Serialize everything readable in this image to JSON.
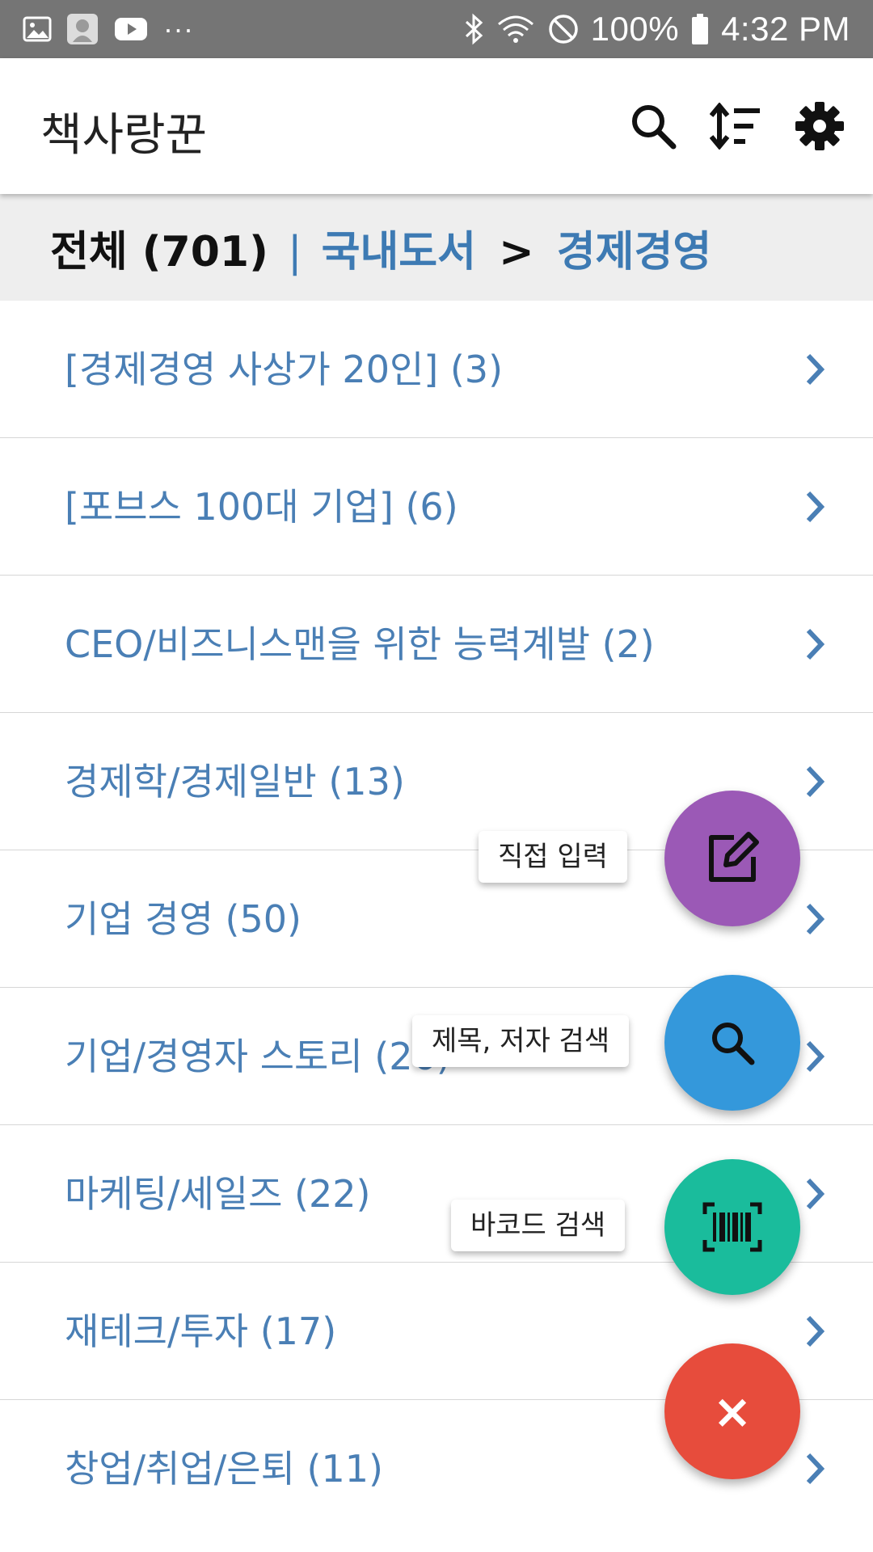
{
  "status_bar": {
    "battery": "100%",
    "time": "4:32 PM",
    "overflow": "···"
  },
  "app_bar": {
    "title": "책사랑꾼"
  },
  "breadcrumb": {
    "all_label": "전체 (701)",
    "separator": "|",
    "level1": "국내도서",
    "arrow": ">",
    "level2": "경제경영"
  },
  "categories": [
    {
      "label": "[경제경영 사상가 20인] (3)"
    },
    {
      "label": "[포브스 100대 기업] (6)"
    },
    {
      "label": "CEO/비즈니스맨을 위한 능력계발 (2)"
    },
    {
      "label": "경제학/경제일반 (13)"
    },
    {
      "label": "기업 경영 (50)"
    },
    {
      "label": "기업/경영자 스토리 (26)"
    },
    {
      "label": "마케팅/세일즈 (22)"
    },
    {
      "label": "재테크/투자 (17)"
    },
    {
      "label": "창업/취업/은퇴 (11)"
    }
  ],
  "fab_menu": {
    "manual_entry": "직접 입력",
    "title_author_search": "제목, 저자 검색",
    "barcode_search": "바코드 검색",
    "close": "×"
  },
  "colors": {
    "manual_entry": "#9b59b6",
    "title_author_search": "#3498db",
    "barcode_search": "#1abc9c",
    "close": "#e74c3c",
    "link": "#3d7ab3"
  }
}
